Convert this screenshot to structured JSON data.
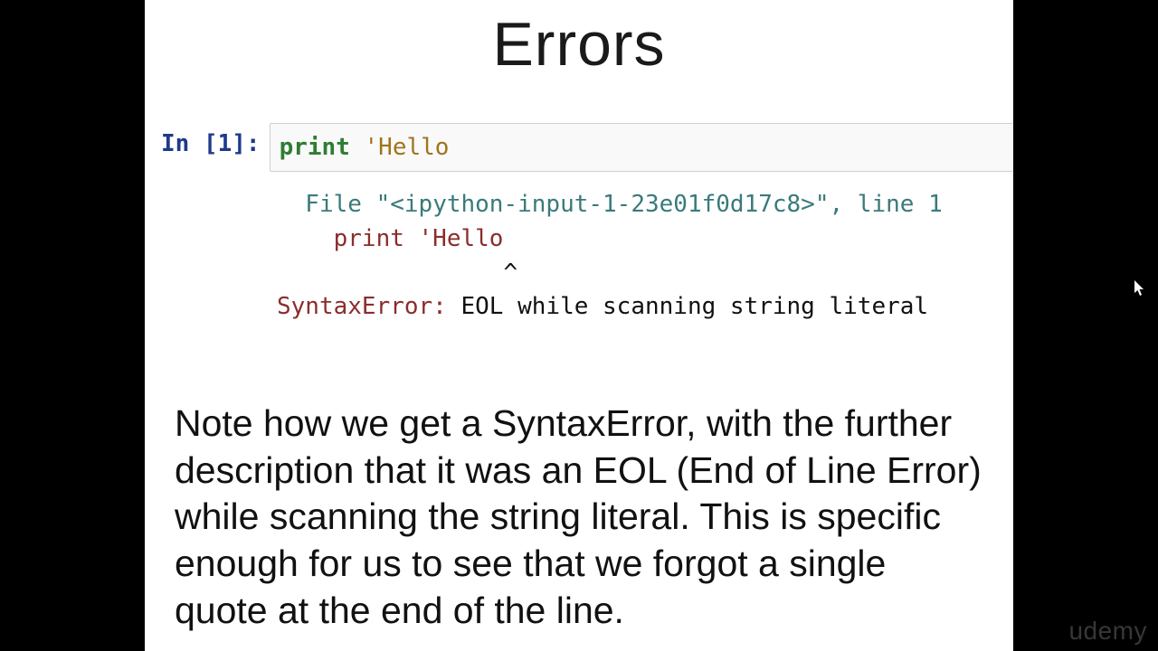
{
  "title": "Errors",
  "cell": {
    "prompt": "In [1]:",
    "input_keyword": "print",
    "input_string": " 'Hello"
  },
  "traceback": {
    "file_prefix": "  File ",
    "file_name": "\"<ipython-input-1-23e01f0d17c8>\"",
    "file_suffix": ", ",
    "line_part": "line 1",
    "echo": "    print 'Hello",
    "caret": "                ^",
    "error_type": "SyntaxError:",
    "error_msg": " EOL while scanning string literal"
  },
  "note": "Note how we get a SyntaxError, with the further description that it was an EOL (End of Line Error) while scanning the string literal. This is specific enough for us to see that we forgot a single quote at the end of the line.",
  "logo": "udemy"
}
